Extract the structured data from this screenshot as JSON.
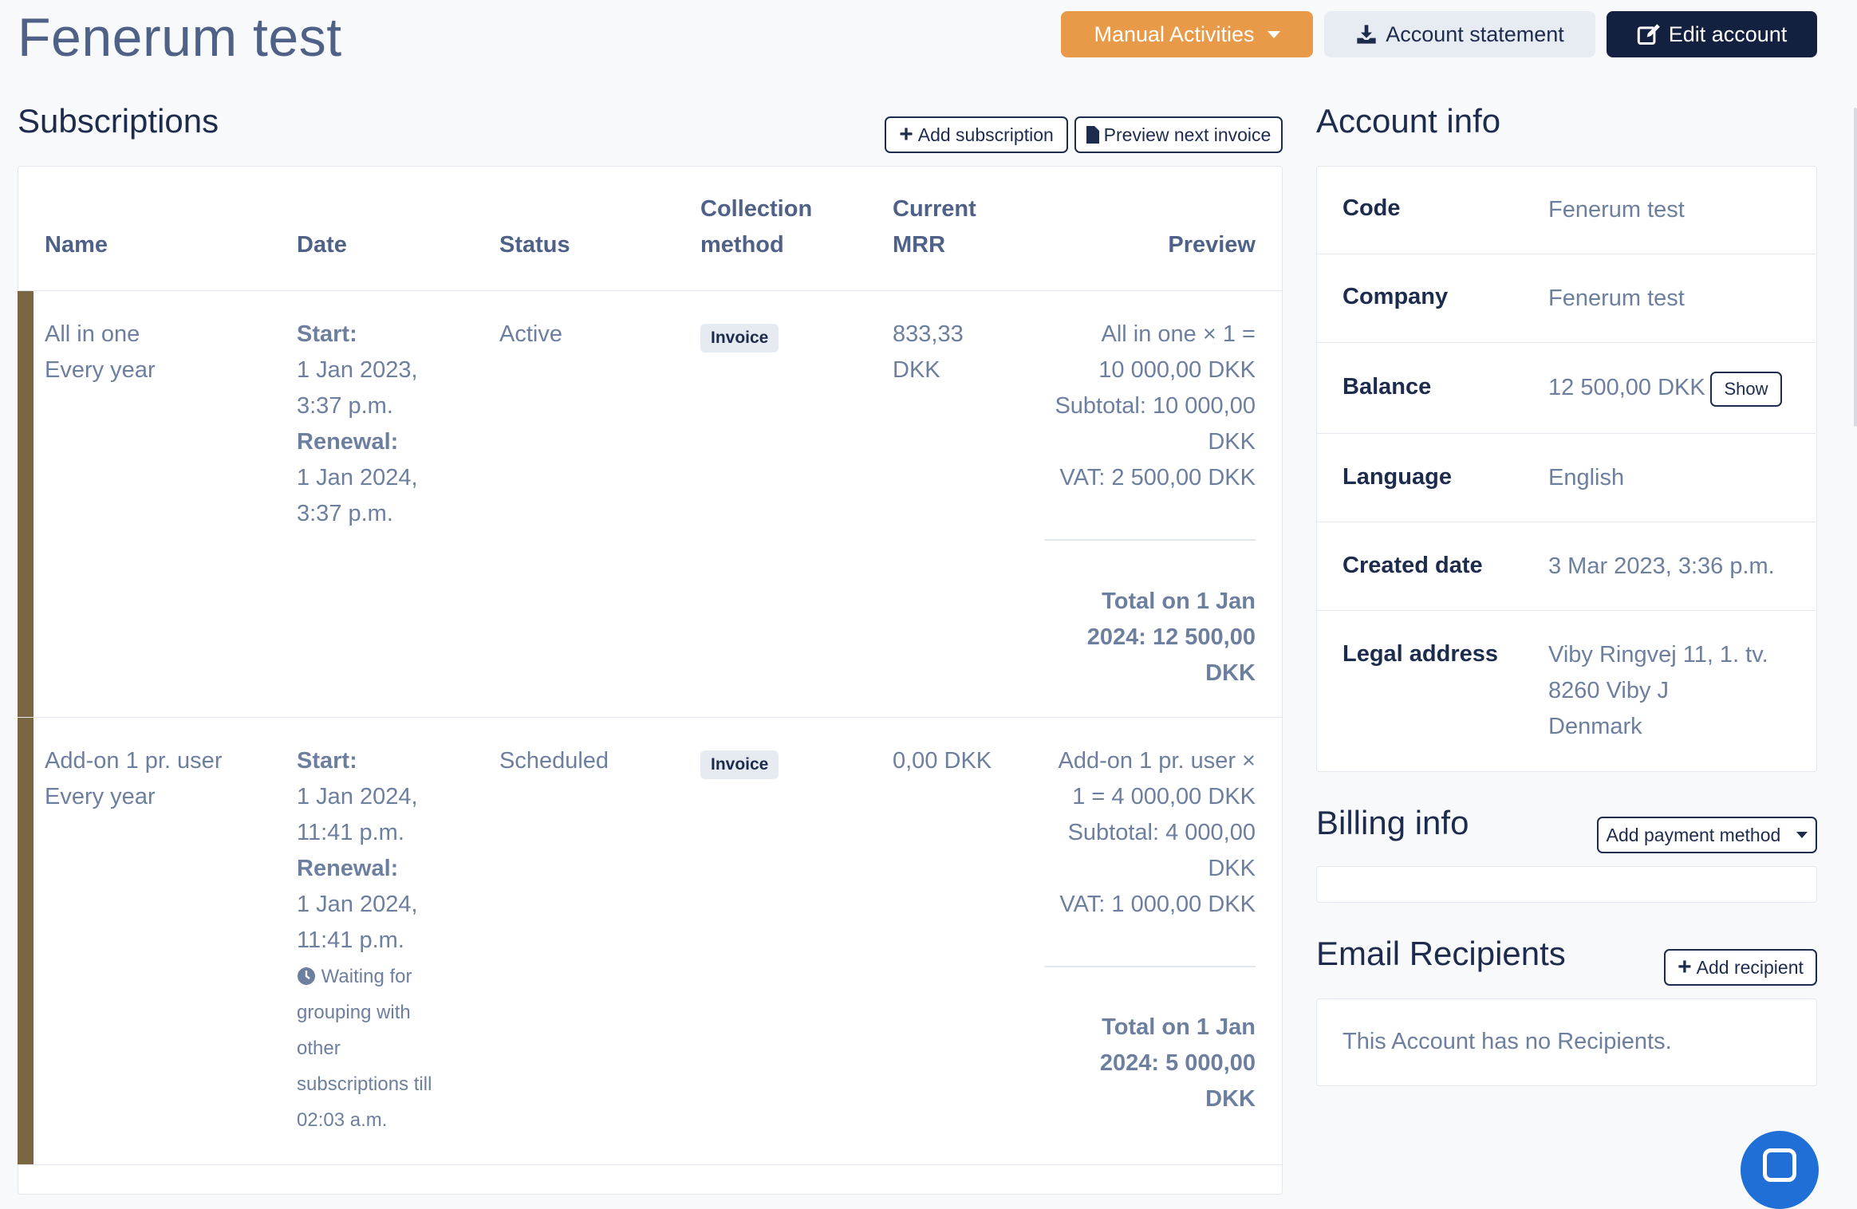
{
  "header": {
    "title": "Fenerum test",
    "manual_activities": "Manual Activities",
    "account_statement": "Account statement",
    "edit_account": "Edit account"
  },
  "subscriptions": {
    "title": "Subscriptions",
    "add_subscription": "Add subscription",
    "preview_next_invoice": "Preview next invoice",
    "columns": {
      "name": "Name",
      "date": "Date",
      "status": "Status",
      "collection_1": "Collection",
      "collection_2": "method",
      "mrr_1": "Current",
      "mrr_2": "MRR",
      "preview": "Preview"
    },
    "rows": [
      {
        "name": "All in one",
        "interval": "Every year",
        "start_label": "Start:",
        "start_1": "1 Jan 2023,",
        "start_2": "3:37 p.m.",
        "renewal_label": "Renewal:",
        "renewal_1": "1 Jan 2024,",
        "renewal_2": "3:37 p.m.",
        "status": "Active",
        "collection": "Invoice",
        "mrr_1": "833,33",
        "mrr_2": "DKK",
        "preview_lines": [
          "All in one × 1 =",
          "10 000,00 DKK",
          "Subtotal: 10 000,00",
          "DKK",
          "VAT: 2 500,00 DKK"
        ],
        "total_lines": [
          "Total on 1 Jan",
          "2024: 12 500,00",
          "DKK"
        ]
      },
      {
        "name": "Add-on 1 pr. user",
        "interval": "Every year",
        "start_label": "Start:",
        "start_1": "1 Jan 2024,",
        "start_2": "11:41 p.m.",
        "renewal_label": "Renewal:",
        "renewal_1": "1 Jan 2024,",
        "renewal_2": "11:41 p.m.",
        "status": "Scheduled",
        "collection": "Invoice",
        "mrr_1": "0,00 DKK",
        "waiting_lines": [
          "Waiting for",
          "grouping with",
          "other",
          "subscriptions till",
          "02:03 a.m."
        ],
        "preview_lines": [
          "Add-on 1 pr. user ×",
          "1 = 4 000,00 DKK",
          "Subtotal: 4 000,00",
          "DKK",
          "VAT: 1 000,00 DKK"
        ],
        "total_lines": [
          "Total on 1 Jan",
          "2024: 5 000,00",
          "DKK"
        ]
      }
    ]
  },
  "account_info": {
    "title": "Account info",
    "code_label": "Code",
    "code_value": "Fenerum test",
    "company_label": "Company",
    "company_value": "Fenerum test",
    "balance_label": "Balance",
    "balance_value": "12 500,00 DKK",
    "show": "Show",
    "language_label": "Language",
    "language_value": "English",
    "created_label": "Created date",
    "created_value": "3 Mar 2023, 3:36 p.m.",
    "address_label": "Legal address",
    "address_1": "Viby Ringvej 11, 1. tv.",
    "address_2": "8260 Viby J",
    "address_3": "Denmark"
  },
  "billing_info": {
    "title": "Billing info",
    "add_payment_method": "Add payment method"
  },
  "email_recipients": {
    "title": "Email Recipients",
    "add_recipient": "Add recipient",
    "empty": "This Account has no Recipients."
  },
  "colors": {
    "accent_orange": "#e99a48",
    "navy": "#14203f",
    "row_bar": "#7a6640",
    "chat": "#1f6fd6"
  }
}
